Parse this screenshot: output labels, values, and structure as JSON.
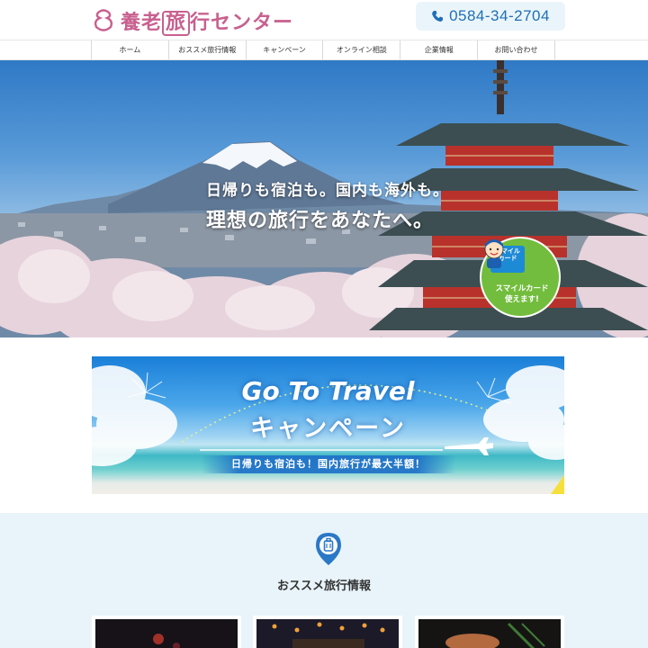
{
  "header": {
    "logo_text_pre": "養老",
    "logo_text_boxed": "旅",
    "logo_text_post": "行センター",
    "phone": "0584-34-2704"
  },
  "nav": {
    "items": [
      {
        "label": "ホーム"
      },
      {
        "label": "おススメ旅行情報"
      },
      {
        "label": "キャンペーン"
      },
      {
        "label": "オンライン相談"
      },
      {
        "label": "企業情報"
      },
      {
        "label": "お問い合わせ"
      }
    ]
  },
  "hero": {
    "line1": "日帰りも宿泊も。国内も海外も。",
    "line2": "理想の旅行をあなたへ。",
    "badge": {
      "card_label_1": "スマイル",
      "card_label_2": "カード",
      "caption_1": "スマイルカード",
      "caption_2": "使えます!"
    }
  },
  "banner": {
    "title": "Go To Travel",
    "subtitle": "キャンペーン",
    "tagline": "日帰りも宿泊も！国内旅行が最大半額！"
  },
  "recommend": {
    "title": "おススメ旅行情報"
  },
  "colors": {
    "brand_pink": "#c8608f",
    "phone_blue": "#1f6fb5",
    "section_bg": "#e8f4fa",
    "badge_green": "#73bd3e"
  }
}
